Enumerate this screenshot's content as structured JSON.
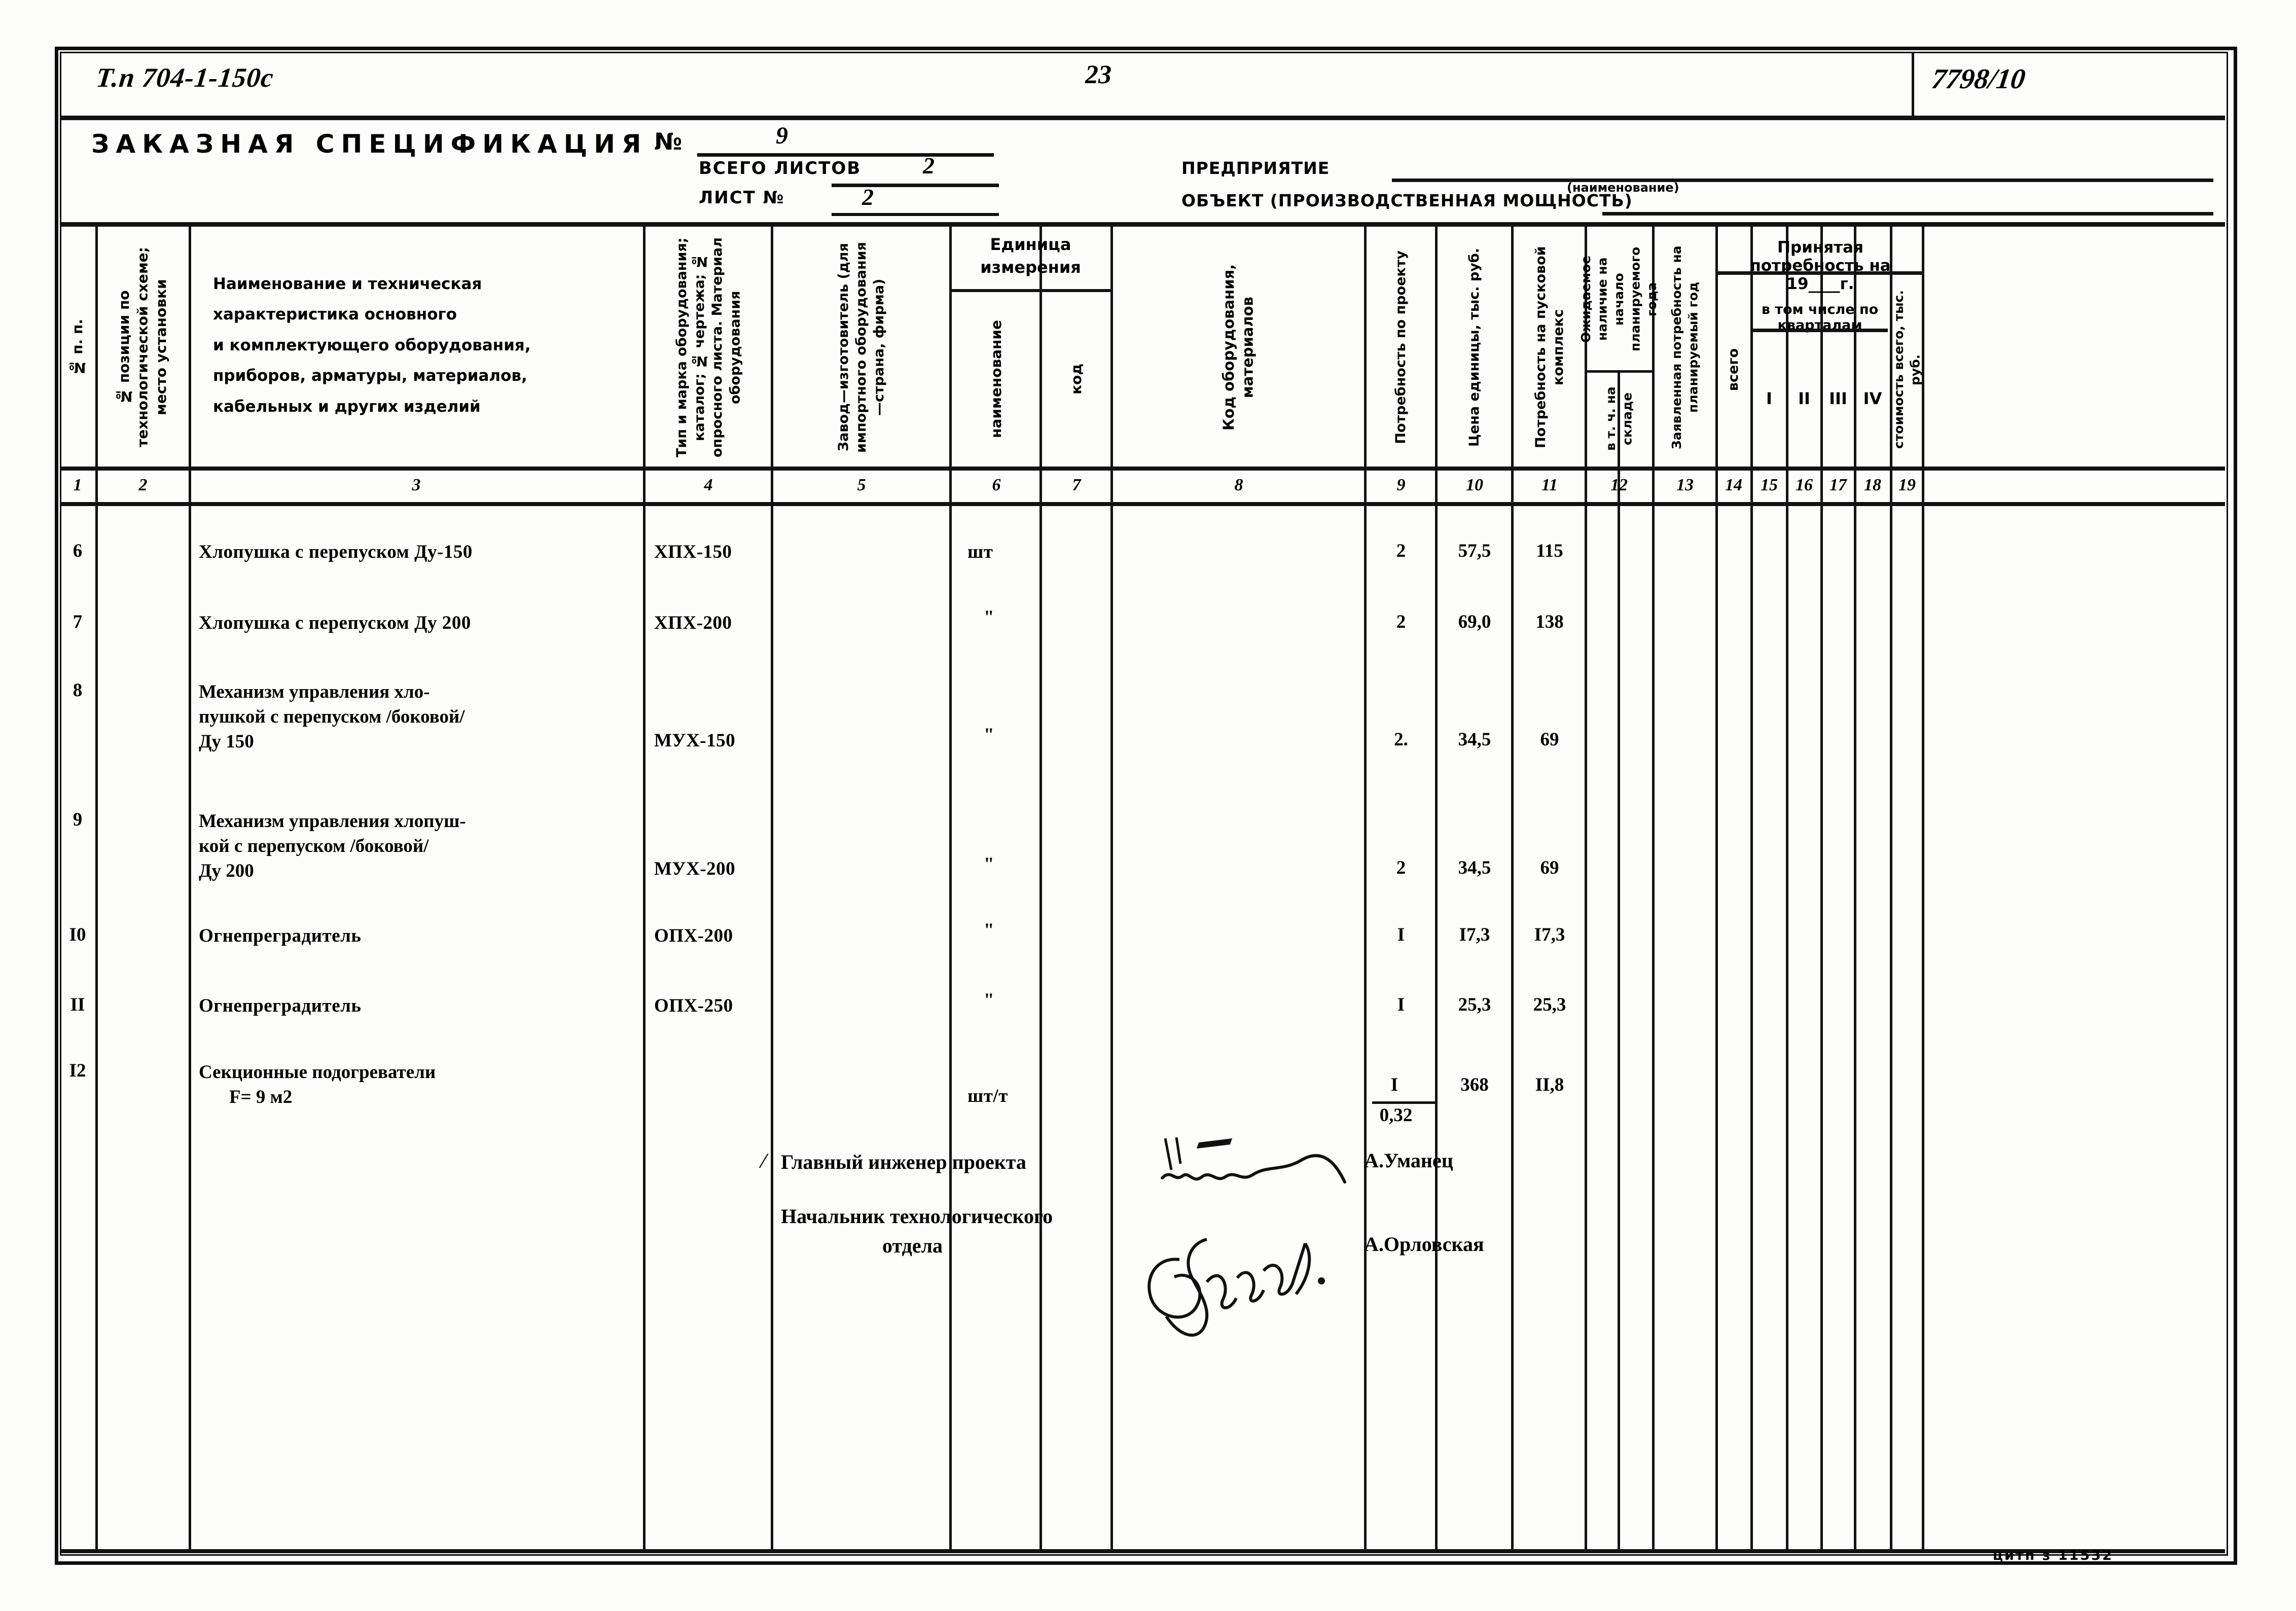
{
  "top": {
    "left_code": "Т.п 704-1-150с",
    "page_number": "23",
    "right_code": "7798/10"
  },
  "header": {
    "title": "ЗАКАЗНАЯ СПЕЦИФИКАЦИЯ",
    "no_label": "№",
    "no_value": "9",
    "total_sheets_label": "ВСЕГО ЛИСТОВ",
    "total_sheets_value": "2",
    "sheet_no_label": "ЛИСТ №",
    "sheet_no_value": "2",
    "enterprise_label": "ПРЕДПРИЯТИЕ",
    "enterprise_hint": "(наименование)",
    "object_label": "ОБЪЕКТ (ПРОИЗВОДСТВЕННАЯ  МОЩНОСТЬ)"
  },
  "columns": {
    "c1": "№ п. п.",
    "c2": "№ позиции по технологической схеме; место установки",
    "c3": "Наименование и техническая характеристика основного и комплектующего оборудования, приборов, арматуры, материалов, кабельных и других изделий",
    "c3_lines": [
      "Наименование и техническая",
      "характеристика основного",
      "и комплектующего оборудования,",
      "приборов, арматуры, материалов,",
      "кабельных и других изделий"
    ],
    "c4": "Тип и марка оборудования; каталог; № чертежа; № опросного листа. Материал оборудования",
    "c5": "Завод—изготовитель (для импортного оборудования —страна, фирма)",
    "c67_group": "Единица измерения",
    "c6": "наименование",
    "c7": "код",
    "c8": "Код оборудования, материалов",
    "c9": "Потребность по проекту",
    "c10": "Цена единицы, тыс. руб.",
    "c11": "Потребность на пусковой комплекс",
    "c12": "Ожидаемое наличие на начало планируемого года",
    "c12sub": "в т. ч. на складе",
    "c13": "Заявленная потребность на планируемый год",
    "right_group": "Принятая потребность на 19____г.",
    "c14": "всего",
    "quarters_group": "в том числе по кварталам",
    "c15": "I",
    "c16": "II",
    "c17": "III",
    "c18": "IV",
    "c19": "стоимость всего, тыс. руб."
  },
  "column_numbers": [
    "1",
    "2",
    "3",
    "4",
    "5",
    "6",
    "7",
    "8",
    "9",
    "10",
    "11",
    "12",
    "13",
    "14",
    "15",
    "16",
    "17",
    "18",
    "19"
  ],
  "rows": [
    {
      "no": "6",
      "name": [
        "Хлопушка с перепуском Ду-150"
      ],
      "type": "ХПХ-150",
      "unit": "шт",
      "qty": "2",
      "price": "57,5",
      "complex": "115"
    },
    {
      "no": "7",
      "name": [
        "Хлопушка с перепуском Ду 200"
      ],
      "type": "ХПХ-200",
      "unit": "\"",
      "qty": "2",
      "price": "69,0",
      "complex": "138"
    },
    {
      "no": "8",
      "name": [
        "Механизм управления хло-",
        "пушкой с перепуском /боковой/",
        "Ду 150"
      ],
      "type": "МУХ-150",
      "unit": "\"",
      "qty": "2.",
      "price": "34,5",
      "complex": "69"
    },
    {
      "no": "9",
      "name": [
        "Механизм управления хлопуш-",
        "кой с перепуском /боковой/",
        "Ду 200"
      ],
      "type": "МУХ-200",
      "unit": "\"",
      "qty": "2",
      "price": "34,5",
      "complex": "69"
    },
    {
      "no": "I0",
      "name": [
        "Огнепреградитель"
      ],
      "type": "ОПХ-200",
      "unit": "\"",
      "qty": "I",
      "price": "I7,3",
      "complex": "I7,3"
    },
    {
      "no": "II",
      "name": [
        "Огнепреградитель"
      ],
      "type": "ОПХ-250",
      "unit": "\"",
      "qty": "I",
      "price": "25,3",
      "complex": "25,3"
    },
    {
      "no": "I2",
      "name": [
        "Секционные подогреватели",
        "F= 9 м2"
      ],
      "type": "",
      "unit": "шт/т",
      "qty": "I",
      "qty_denom": "0,32",
      "price": "368",
      "complex": "II,8"
    }
  ],
  "signatures": [
    {
      "role": [
        "Главный инженер проекта"
      ],
      "name": "А.Уманец"
    },
    {
      "role": [
        "Начальник технологического",
        "отдела"
      ],
      "name": "А.Орловская"
    }
  ],
  "footer": {
    "stamp": "цитп  з 11532"
  }
}
